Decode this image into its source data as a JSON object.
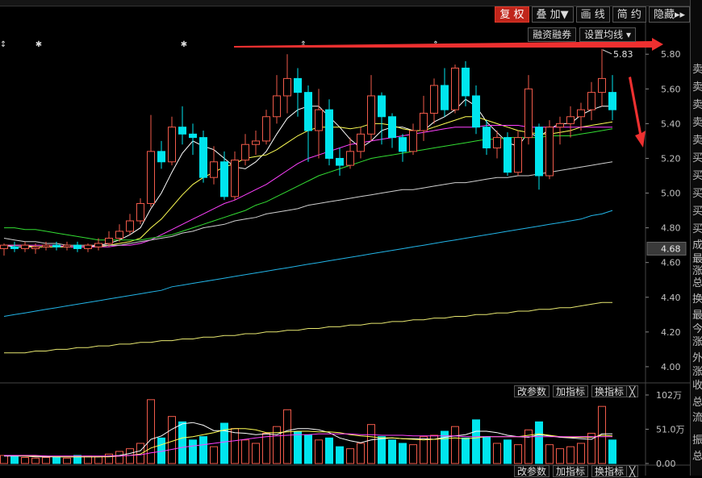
{
  "toolbar": {
    "buttons": [
      "复 权",
      "叠 加▼",
      "画 线",
      "简 约",
      "隐藏▸▸"
    ],
    "sub_buttons": [
      "融资融券",
      "设置均线 ▾"
    ]
  },
  "indicator_buttons": {
    "params": "改参数",
    "add": "加指标",
    "switch": "换指标",
    "close": "╳"
  },
  "right_panel_chars": [
    "卖",
    "卖",
    "卖",
    "卖",
    "卖",
    "买",
    "买",
    "买",
    "买",
    "买",
    "成",
    "最",
    "涨",
    "总",
    "换",
    "最",
    "今",
    "涨",
    "外",
    "涨",
    "收",
    "总",
    "流",
    "振",
    "总"
  ],
  "colors": {
    "up": "#f05a4a",
    "down": "#00e5ee",
    "ma5": "#ffffff",
    "ma10": "#ffff55",
    "ma20": "#ff40ff",
    "ma30": "#33dd33",
    "ma60": "#d0d0d0",
    "ma120": "#22b5e8",
    "ma250": "#e8e870",
    "annotation": "#ee3030",
    "axis_text": "#c0c0c0"
  },
  "chart_data": [
    {
      "type": "candlestick",
      "ylim": [
        3.93,
        5.88
      ],
      "y_ticks": [
        "5.80",
        "5.60",
        "5.40",
        "5.20",
        "5.00",
        "4.80",
        "4.60",
        "4.40",
        "4.20",
        "4.00"
      ],
      "y_tick_values": [
        5.8,
        5.6,
        5.4,
        5.2,
        5.0,
        4.8,
        4.6,
        4.4,
        4.2,
        4.0
      ],
      "current_price_label": "4.68",
      "max_label": "5.83",
      "candles": [
        [
          4.68,
          4.7,
          4.64,
          4.71
        ],
        [
          4.69,
          4.68,
          4.66,
          4.72
        ],
        [
          4.68,
          4.7,
          4.66,
          4.72
        ],
        [
          4.68,
          4.69,
          4.65,
          4.71
        ],
        [
          4.69,
          4.7,
          4.67,
          4.72
        ],
        [
          4.7,
          4.69,
          4.67,
          4.72
        ],
        [
          4.69,
          4.7,
          4.67,
          4.72
        ],
        [
          4.7,
          4.68,
          4.66,
          4.72
        ],
        [
          4.68,
          4.7,
          4.66,
          4.71
        ],
        [
          4.69,
          4.71,
          4.67,
          4.74
        ],
        [
          4.71,
          4.74,
          4.69,
          4.78
        ],
        [
          4.74,
          4.78,
          4.72,
          4.82
        ],
        [
          4.78,
          4.84,
          4.76,
          4.88
        ],
        [
          4.84,
          4.94,
          4.82,
          4.97
        ],
        [
          4.94,
          5.24,
          4.92,
          5.45
        ],
        [
          5.24,
          5.18,
          5.14,
          5.3
        ],
        [
          5.18,
          5.38,
          5.16,
          5.44
        ],
        [
          5.38,
          5.34,
          5.28,
          5.5
        ],
        [
          5.34,
          5.32,
          5.22,
          5.4
        ],
        [
          5.32,
          5.09,
          5.06,
          5.36
        ],
        [
          5.09,
          5.18,
          5.05,
          5.27
        ],
        [
          5.18,
          4.98,
          4.96,
          5.24
        ],
        [
          4.98,
          5.19,
          4.96,
          5.24
        ],
        [
          5.19,
          5.28,
          5.16,
          5.34
        ],
        [
          5.28,
          5.3,
          5.22,
          5.36
        ],
        [
          5.3,
          5.44,
          5.28,
          5.48
        ],
        [
          5.44,
          5.56,
          5.4,
          5.68
        ],
        [
          5.56,
          5.66,
          5.46,
          5.8
        ],
        [
          5.66,
          5.58,
          5.44,
          5.72
        ],
        [
          5.58,
          5.36,
          5.18,
          5.62
        ],
        [
          5.36,
          5.48,
          5.2,
          5.6
        ],
        [
          5.48,
          5.2,
          5.16,
          5.54
        ],
        [
          5.2,
          5.16,
          5.1,
          5.26
        ],
        [
          5.16,
          5.24,
          5.14,
          5.32
        ],
        [
          5.24,
          5.34,
          5.2,
          5.38
        ],
        [
          5.34,
          5.56,
          5.3,
          5.68
        ],
        [
          5.56,
          5.44,
          5.28,
          5.58
        ],
        [
          5.44,
          5.32,
          5.26,
          5.46
        ],
        [
          5.32,
          5.24,
          5.18,
          5.34
        ],
        [
          5.24,
          5.36,
          5.22,
          5.4
        ],
        [
          5.36,
          5.46,
          5.3,
          5.56
        ],
        [
          5.46,
          5.62,
          5.4,
          5.66
        ],
        [
          5.62,
          5.48,
          5.44,
          5.72
        ],
        [
          5.48,
          5.72,
          5.46,
          5.74
        ],
        [
          5.72,
          5.56,
          5.5,
          5.76
        ],
        [
          5.56,
          5.38,
          5.34,
          5.62
        ],
        [
          5.38,
          5.26,
          5.22,
          5.42
        ],
        [
          5.26,
          5.32,
          5.2,
          5.36
        ],
        [
          5.32,
          5.12,
          5.1,
          5.35
        ],
        [
          5.12,
          5.32,
          5.1,
          5.36
        ],
        [
          5.32,
          5.6,
          5.28,
          5.68
        ],
        [
          5.38,
          5.1,
          5.02,
          5.4
        ],
        [
          5.1,
          5.38,
          5.08,
          5.42
        ],
        [
          5.38,
          5.4,
          5.28,
          5.44
        ],
        [
          5.4,
          5.44,
          5.32,
          5.5
        ],
        [
          5.44,
          5.48,
          5.36,
          5.52
        ],
        [
          5.48,
          5.58,
          5.42,
          5.64
        ],
        [
          5.58,
          5.66,
          5.5,
          5.83
        ],
        [
          5.58,
          5.48,
          5.42,
          5.68
        ]
      ],
      "ma_series": [
        {
          "key": "ma5",
          "values": [
            4.7,
            4.69,
            4.69,
            4.69,
            4.69,
            4.69,
            4.69,
            4.69,
            4.69,
            4.7,
            4.71,
            4.73,
            4.76,
            4.8,
            4.91,
            5.0,
            5.12,
            5.23,
            5.3,
            5.27,
            5.25,
            5.2,
            5.15,
            5.14,
            5.18,
            5.24,
            5.34,
            5.43,
            5.48,
            5.5,
            5.5,
            5.44,
            5.38,
            5.31,
            5.26,
            5.3,
            5.36,
            5.38,
            5.38,
            5.36,
            5.36,
            5.41,
            5.44,
            5.48,
            5.54,
            5.5,
            5.41,
            5.35,
            5.29,
            5.27,
            5.35,
            5.32,
            5.37,
            5.4,
            5.4,
            5.45,
            5.48,
            5.5,
            5.5
          ]
        },
        {
          "key": "ma10",
          "values": [
            4.7,
            4.7,
            4.7,
            4.69,
            4.69,
            4.69,
            4.69,
            4.69,
            4.69,
            4.69,
            4.7,
            4.71,
            4.72,
            4.74,
            4.8,
            4.85,
            4.92,
            4.99,
            5.05,
            5.09,
            5.12,
            5.15,
            5.17,
            5.2,
            5.21,
            5.22,
            5.25,
            5.29,
            5.33,
            5.36,
            5.38,
            5.38,
            5.38,
            5.37,
            5.38,
            5.4,
            5.4,
            5.39,
            5.37,
            5.36,
            5.36,
            5.38,
            5.4,
            5.42,
            5.44,
            5.44,
            5.42,
            5.4,
            5.38,
            5.36,
            5.35,
            5.34,
            5.34,
            5.35,
            5.36,
            5.38,
            5.39,
            5.4,
            5.41
          ]
        },
        {
          "key": "ma20",
          "values": [
            4.7,
            4.7,
            4.7,
            4.7,
            4.7,
            4.7,
            4.69,
            4.69,
            4.69,
            4.69,
            4.69,
            4.7,
            4.7,
            4.71,
            4.73,
            4.76,
            4.79,
            4.82,
            4.85,
            4.88,
            4.91,
            4.94,
            4.96,
            4.99,
            5.02,
            5.05,
            5.09,
            5.13,
            5.17,
            5.2,
            5.22,
            5.24,
            5.26,
            5.28,
            5.29,
            5.3,
            5.31,
            5.32,
            5.33,
            5.34,
            5.35,
            5.36,
            5.37,
            5.38,
            5.38,
            5.38,
            5.39,
            5.39,
            5.39,
            5.39,
            5.38,
            5.38,
            5.38,
            5.38,
            5.38,
            5.38,
            5.38,
            5.38,
            5.38
          ]
        },
        {
          "key": "ma30",
          "values": [
            4.8,
            4.8,
            4.79,
            4.79,
            4.78,
            4.77,
            4.76,
            4.75,
            4.74,
            4.73,
            4.73,
            4.73,
            4.73,
            4.73,
            4.74,
            4.75,
            4.76,
            4.78,
            4.8,
            4.82,
            4.84,
            4.86,
            4.88,
            4.9,
            4.93,
            4.95,
            4.98,
            5.01,
            5.04,
            5.07,
            5.1,
            5.12,
            5.14,
            5.16,
            5.18,
            5.2,
            5.21,
            5.22,
            5.23,
            5.24,
            5.25,
            5.26,
            5.27,
            5.28,
            5.29,
            5.3,
            5.31,
            5.31,
            5.32,
            5.32,
            5.32,
            5.32,
            5.33,
            5.33,
            5.33,
            5.34,
            5.35,
            5.36,
            5.37
          ]
        },
        {
          "key": "ma60",
          "values": [
            4.74,
            4.73,
            4.72,
            4.72,
            4.71,
            4.71,
            4.7,
            4.7,
            4.7,
            4.7,
            4.7,
            4.7,
            4.71,
            4.72,
            4.73,
            4.74,
            4.75,
            4.77,
            4.78,
            4.8,
            4.81,
            4.82,
            4.84,
            4.85,
            4.86,
            4.88,
            4.89,
            4.9,
            4.91,
            4.93,
            4.94,
            4.95,
            4.96,
            4.97,
            4.98,
            4.99,
            5.0,
            5.01,
            5.02,
            5.02,
            5.03,
            5.04,
            5.05,
            5.06,
            5.06,
            5.07,
            5.08,
            5.09,
            5.09,
            5.1,
            5.1,
            5.11,
            5.12,
            5.13,
            5.14,
            5.15,
            5.16,
            5.17,
            5.18
          ]
        },
        {
          "key": "ma120",
          "values": [
            4.29,
            4.3,
            4.31,
            4.32,
            4.33,
            4.34,
            4.35,
            4.36,
            4.37,
            4.38,
            4.39,
            4.4,
            4.41,
            4.42,
            4.43,
            4.44,
            4.46,
            4.47,
            4.48,
            4.49,
            4.5,
            4.51,
            4.52,
            4.53,
            4.54,
            4.55,
            4.56,
            4.57,
            4.58,
            4.59,
            4.6,
            4.61,
            4.62,
            4.63,
            4.64,
            4.65,
            4.66,
            4.67,
            4.68,
            4.69,
            4.7,
            4.71,
            4.72,
            4.73,
            4.74,
            4.75,
            4.76,
            4.77,
            4.78,
            4.79,
            4.8,
            4.81,
            4.82,
            4.83,
            4.84,
            4.85,
            4.87,
            4.88,
            4.9
          ]
        },
        {
          "key": "ma250",
          "values": [
            4.08,
            4.08,
            4.08,
            4.09,
            4.09,
            4.1,
            4.1,
            4.11,
            4.11,
            4.12,
            4.12,
            4.13,
            4.13,
            4.14,
            4.14,
            4.15,
            4.15,
            4.16,
            4.16,
            4.17,
            4.17,
            4.18,
            4.18,
            4.19,
            4.19,
            4.2,
            4.2,
            4.21,
            4.21,
            4.22,
            4.22,
            4.23,
            4.23,
            4.24,
            4.24,
            4.25,
            4.25,
            4.26,
            4.26,
            4.27,
            4.27,
            4.28,
            4.28,
            4.29,
            4.29,
            4.3,
            4.3,
            4.31,
            4.31,
            4.32,
            4.32,
            4.33,
            4.33,
            4.34,
            4.34,
            4.35,
            4.36,
            4.37,
            4.37
          ]
        }
      ]
    },
    {
      "type": "bar",
      "ylim": [
        0,
        102
      ],
      "y_ticks": [
        "102万",
        "51.0万",
        "0.00"
      ],
      "y_tick_values": [
        102,
        51,
        0
      ],
      "unit": "万",
      "volumes": [
        12,
        10,
        9,
        8,
        9,
        10,
        8,
        12,
        11,
        10,
        14,
        18,
        22,
        30,
        95,
        38,
        70,
        62,
        35,
        40,
        25,
        60,
        52,
        35,
        30,
        45,
        55,
        80,
        48,
        42,
        35,
        38,
        25,
        22,
        30,
        58,
        40,
        35,
        30,
        28,
        40,
        42,
        48,
        55,
        38,
        65,
        40,
        30,
        35,
        28,
        50,
        62,
        28,
        22,
        25,
        30,
        45,
        85,
        35
      ],
      "ma_series": [
        {
          "key": "vol_ma5",
          "color": "#ffffff",
          "values": [
            11,
            11,
            11,
            10,
            10,
            10,
            10,
            10,
            10,
            10,
            11,
            12,
            15,
            19,
            36,
            41,
            51,
            59,
            61,
            57,
            49,
            49,
            46,
            45,
            43,
            44,
            43,
            49,
            52,
            52,
            50,
            46,
            38,
            34,
            31,
            35,
            37,
            38,
            37,
            37,
            37,
            36,
            39,
            41,
            43,
            48,
            48,
            46,
            42,
            40,
            39,
            43,
            41,
            39,
            38,
            37,
            36,
            44,
            44
          ]
        },
        {
          "key": "vol_ma10",
          "color": "#ffff55",
          "values": [
            12,
            12,
            11,
            11,
            11,
            10,
            10,
            10,
            10,
            10,
            10,
            11,
            12,
            14,
            23,
            28,
            33,
            38,
            40,
            43,
            46,
            50,
            52,
            52,
            50,
            46,
            46,
            47,
            48,
            48,
            47,
            47,
            46,
            43,
            41,
            40,
            38,
            38,
            37,
            36,
            35,
            36,
            37,
            38,
            37,
            38,
            40,
            40,
            40,
            40,
            42,
            44,
            42,
            40,
            39,
            39,
            39,
            42,
            41
          ]
        },
        {
          "key": "vol_ma20",
          "color": "#ff40ff",
          "values": [
            12,
            12,
            12,
            12,
            11,
            11,
            11,
            11,
            11,
            11,
            11,
            11,
            12,
            13,
            16,
            18,
            21,
            24,
            26,
            28,
            30,
            32,
            34,
            36,
            38,
            40,
            41,
            42,
            43,
            43,
            44,
            44,
            44,
            44,
            43,
            43,
            42,
            42,
            42,
            41,
            41,
            41,
            41,
            41,
            40,
            40,
            40,
            40,
            40,
            40,
            40,
            40,
            40,
            40,
            40,
            40,
            40,
            40,
            40
          ]
        }
      ]
    }
  ]
}
